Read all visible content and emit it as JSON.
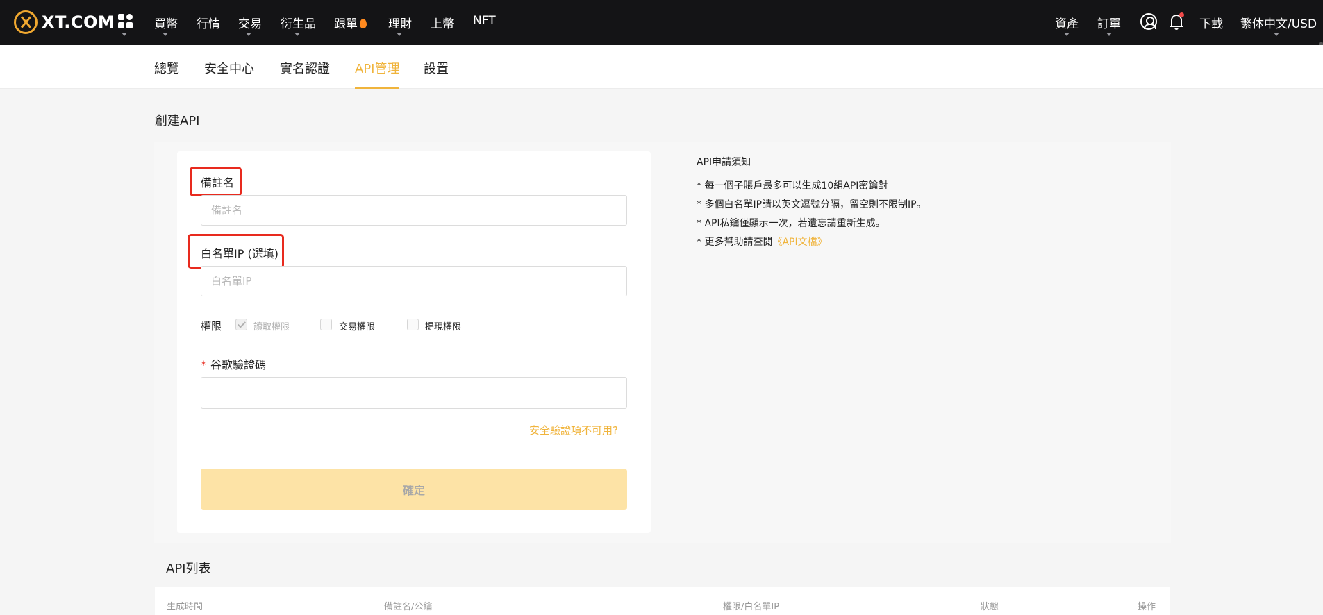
{
  "header": {
    "logo_text": "XT.COM",
    "nav": [
      "買幣",
      "行情",
      "交易",
      "衍生品",
      "跟單",
      "理財",
      "上幣",
      "NFT"
    ],
    "right": {
      "assets": "資產",
      "orders": "訂單",
      "download": "下載",
      "lang_currency": "繁体中文/USD"
    }
  },
  "subnav": {
    "items": [
      "總覽",
      "安全中心",
      "實名認證",
      "API管理",
      "設置"
    ],
    "active": "API管理"
  },
  "page": {
    "title": "創建API"
  },
  "form": {
    "remark_label": "備註名",
    "remark_placeholder": "備註名",
    "whitelist_label": "白名單IP (選填)",
    "whitelist_placeholder": "白名單IP",
    "permissions_label": "權限",
    "permissions": [
      {
        "label": "讀取權限",
        "checked": true,
        "disabled": true
      },
      {
        "label": "交易權限",
        "checked": false,
        "disabled": false
      },
      {
        "label": "提現權限",
        "checked": false,
        "disabled": false
      }
    ],
    "google_required_mark": "*",
    "google_label": "谷歌驗證碼",
    "google_value": "",
    "security_unavailable_link": "安全驗證項不可用?",
    "confirm_button": "確定"
  },
  "notes": {
    "title": "API申請須知",
    "items": [
      "* 每一個子賬戶最多可以生成10組API密鑰對",
      "* 多個白名單IP請以英文逗號分隔，留空則不限制IP。",
      "* API私鑰僅顯示一次，若遺忘請重新生成。"
    ],
    "help_prefix": "* 更多幫助請查閱",
    "help_link": "《API文檔》"
  },
  "api_list": {
    "title": "API列表",
    "columns": [
      "生成時間",
      "備註名/公鑰",
      "權限/白名單IP",
      "狀態",
      "操作"
    ]
  },
  "colors": {
    "accent": "#f0b43c",
    "topbar_bg": "#141416",
    "highlight_red": "#e82a1e",
    "button_disabled_bg": "#fde3a6"
  }
}
